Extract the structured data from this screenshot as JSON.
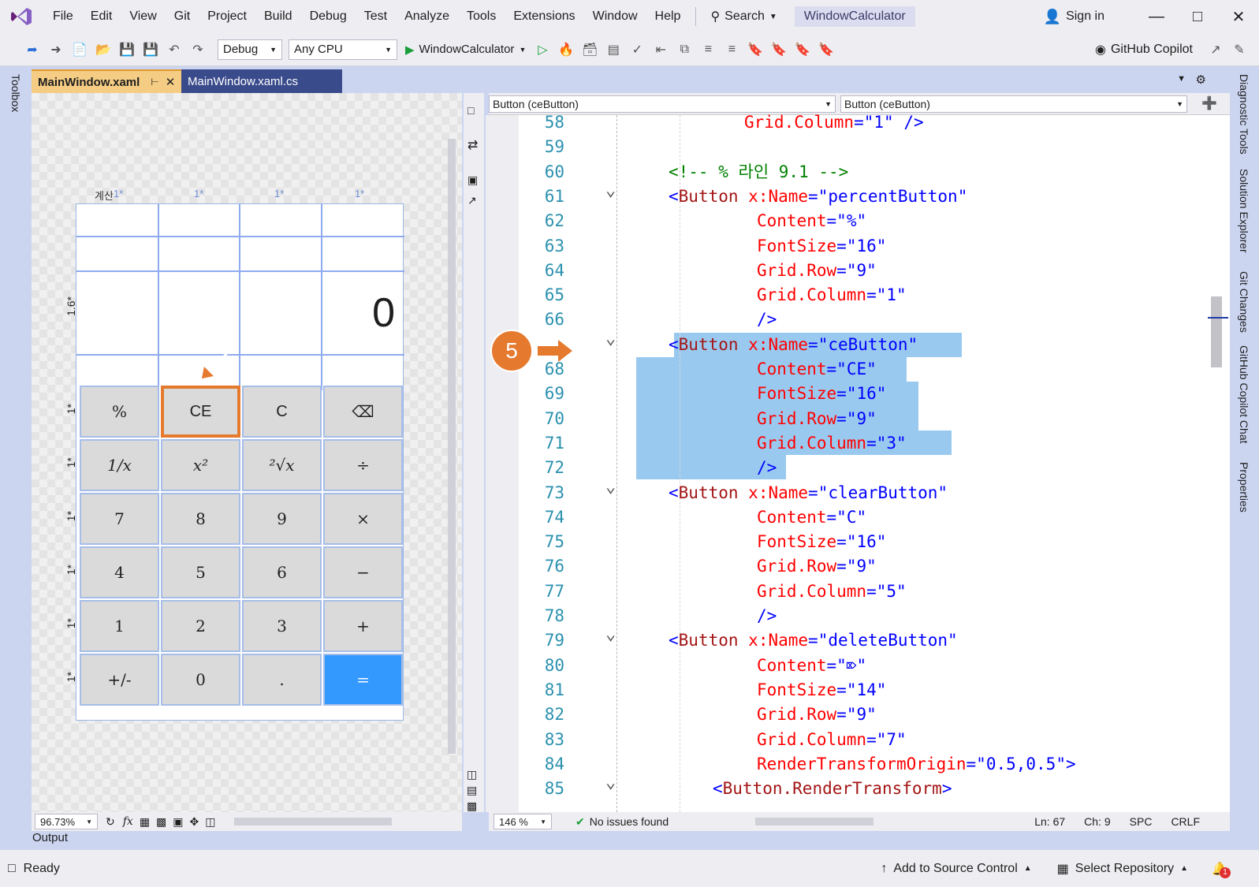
{
  "menu": {
    "items": [
      "File",
      "Edit",
      "View",
      "Git",
      "Project",
      "Build",
      "Debug",
      "Test",
      "Analyze",
      "Tools",
      "Extensions",
      "Window",
      "Help"
    ],
    "search_label": "Search",
    "solution_title": "WindowCalculator",
    "sign_in": "Sign in"
  },
  "toolbar": {
    "config": "Debug",
    "platform": "Any CPU",
    "run_target": "WindowCalculator",
    "copilot": "GitHub Copilot"
  },
  "tabs": [
    {
      "label": "MainWindow.xaml",
      "active": true
    },
    {
      "label": "MainWindow.xaml.cs",
      "active": false
    }
  ],
  "side_left": {
    "toolbox": "Toolbox"
  },
  "side_right": [
    "Diagnostic Tools",
    "Solution Explorer",
    "Git Changes",
    "GitHub Copilot Chat",
    "Properties"
  ],
  "designer": {
    "col_markers": [
      "1*",
      "1*",
      "1*",
      "1*"
    ],
    "row_marker_display": "1.6*",
    "row_marker": "1*",
    "title_fragment": "계산",
    "display_value": "0",
    "buttons": [
      [
        "%",
        "CE",
        "C",
        "⌫"
      ],
      [
        "1/x",
        "x²",
        "²√x",
        "÷"
      ],
      [
        "7",
        "8",
        "9",
        "×"
      ],
      [
        "4",
        "5",
        "6",
        "−"
      ],
      [
        "1",
        "2",
        "3",
        "+"
      ],
      [
        "+/-",
        "0",
        ".",
        "="
      ]
    ],
    "zoom": "96.73%",
    "equals_color": "#3399ff"
  },
  "nav": {
    "left": "Button (ceButton)",
    "right": "Button (ceButton)"
  },
  "callout": {
    "number": "5"
  },
  "code_lines": [
    {
      "n": "58",
      "text": "        Grid.Column=\"1\" />"
    },
    {
      "n": "59",
      "text": ""
    },
    {
      "n": "60",
      "text": "<!-- % 라인 9.1 -->"
    },
    {
      "n": "61",
      "text": "<Button x:Name=\"percentButton\""
    },
    {
      "n": "62",
      "text": "        Content=\"%\""
    },
    {
      "n": "63",
      "text": "        FontSize=\"16\""
    },
    {
      "n": "64",
      "text": "        Grid.Row=\"9\""
    },
    {
      "n": "65",
      "text": "        Grid.Column=\"1\""
    },
    {
      "n": "66",
      "text": "        />"
    },
    {
      "n": "",
      "text": "<Button x:Name=\"ceButton\""
    },
    {
      "n": "68",
      "text": "        Content=\"CE\""
    },
    {
      "n": "69",
      "text": "        FontSize=\"16\""
    },
    {
      "n": "70",
      "text": "        Grid.Row=\"9\""
    },
    {
      "n": "71",
      "text": "        Grid.Column=\"3\""
    },
    {
      "n": "72",
      "text": "        />"
    },
    {
      "n": "73",
      "text": "<Button x:Name=\"clearButton\""
    },
    {
      "n": "74",
      "text": "        Content=\"C\""
    },
    {
      "n": "75",
      "text": "        FontSize=\"16\""
    },
    {
      "n": "76",
      "text": "        Grid.Row=\"9\""
    },
    {
      "n": "77",
      "text": "        Grid.Column=\"5\""
    },
    {
      "n": "78",
      "text": "        />"
    },
    {
      "n": "79",
      "text": "<Button x:Name=\"deleteButton\""
    },
    {
      "n": "80",
      "text": "        Content=\"⌦\""
    },
    {
      "n": "81",
      "text": "        FontSize=\"14\""
    },
    {
      "n": "82",
      "text": "        Grid.Row=\"9\""
    },
    {
      "n": "83",
      "text": "        Grid.Column=\"7\""
    },
    {
      "n": "84",
      "text": "        RenderTransformOrigin=\"0.5,0.5\">"
    },
    {
      "n": "85",
      "text": "    <Button.RenderTransform>"
    }
  ],
  "editor_status": {
    "zoom": "146 %",
    "issues": "No issues found",
    "ln": "Ln: 67",
    "ch": "Ch: 9",
    "spc": "SPC",
    "eol": "CRLF"
  },
  "output_label": "Output",
  "status": {
    "ready": "Ready",
    "source_control": "Add to Source Control",
    "repo": "Select Repository",
    "notifications": "1"
  },
  "colors": {
    "tag": "#a31515",
    "attr": "#ff0000",
    "value": "#0000ff",
    "comment": "#008000",
    "callout": "#e57a2e"
  }
}
